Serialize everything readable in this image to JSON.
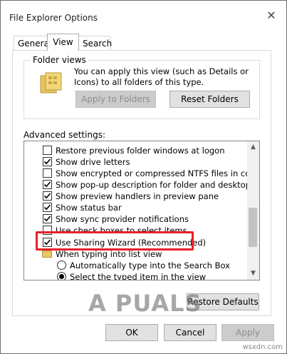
{
  "window": {
    "title": "File Explorer Options",
    "close_glyph": "✕"
  },
  "tabs": [
    {
      "label": "General",
      "selected": false
    },
    {
      "label": "View",
      "selected": true
    },
    {
      "label": "Search",
      "selected": false
    }
  ],
  "folder_views": {
    "title": "Folder views",
    "description": "You can apply this view (such as Details or Icons) to all folders of this type.",
    "apply_label": "Apply to Folders",
    "reset_label": "Reset Folders"
  },
  "advanced": {
    "label": "Advanced settings:",
    "items": [
      {
        "type": "checkbox",
        "label": "Restore previous folder windows at logon",
        "checked": false
      },
      {
        "type": "checkbox",
        "label": "Show drive letters",
        "checked": true
      },
      {
        "type": "checkbox",
        "label": "Show encrypted or compressed NTFS files in color",
        "checked": false
      },
      {
        "type": "checkbox",
        "label": "Show pop-up description for folder and desktop items",
        "checked": true
      },
      {
        "type": "checkbox",
        "label": "Show preview handlers in preview pane",
        "checked": true
      },
      {
        "type": "checkbox",
        "label": "Show status bar",
        "checked": true
      },
      {
        "type": "checkbox",
        "label": "Show sync provider notifications",
        "checked": true
      },
      {
        "type": "checkbox",
        "label": "Use check boxes to select items",
        "checked": false
      },
      {
        "type": "checkbox",
        "label": "Use Sharing Wizard (Recommended)",
        "checked": true
      },
      {
        "type": "folder",
        "label": "When typing into list view"
      },
      {
        "type": "radio",
        "label": "Automatically type into the Search Box",
        "checked": false
      },
      {
        "type": "radio",
        "label": "Select the typed item in the view",
        "checked": true
      }
    ],
    "restore_defaults_label": "Restore Defaults"
  },
  "footer": {
    "ok_label": "OK",
    "cancel_label": "Cancel",
    "apply_label": "Apply"
  },
  "watermark": {
    "text": "A PUALS"
  },
  "credit": "wsxdn.com",
  "colors": {
    "highlight": "#e8202b",
    "accent": "#0078d7"
  }
}
